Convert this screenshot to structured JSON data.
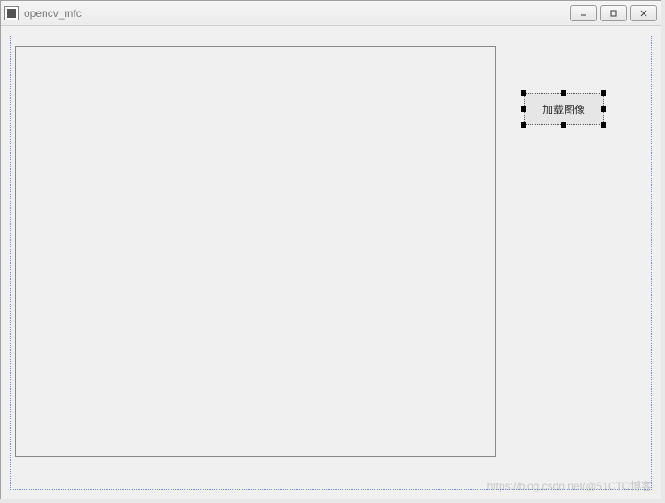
{
  "window": {
    "title": "opencv_mfc"
  },
  "controls": {
    "load_image_button": "加载图像"
  },
  "watermark": "https://blog.csdn.net/@51CTO博客"
}
